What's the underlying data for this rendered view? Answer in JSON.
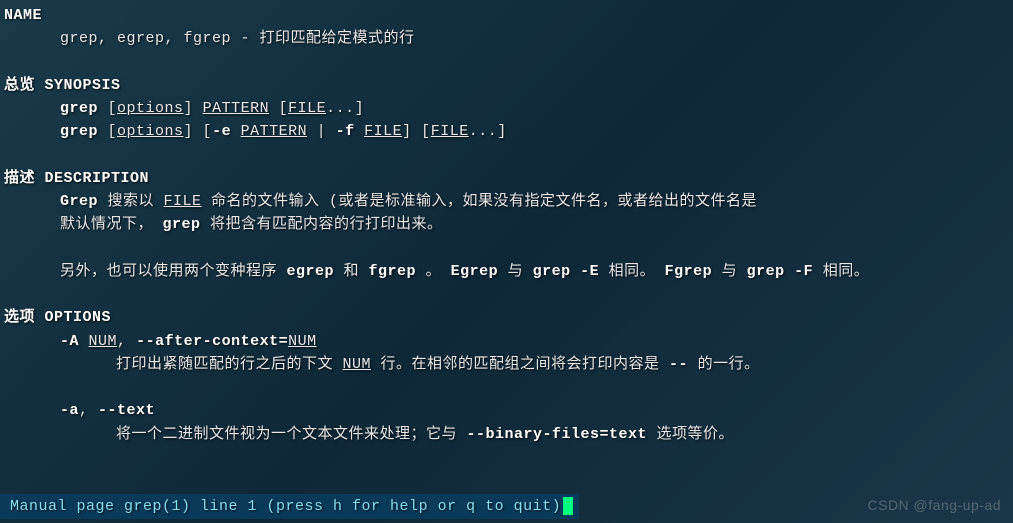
{
  "sections": {
    "name": {
      "header": "NAME",
      "line1": "grep, egrep, fgrep - 打印匹配给定模式的行"
    },
    "synopsis": {
      "header": "总览 SYNOPSIS",
      "line1_bold": "grep",
      "line1_rest_open": " [",
      "line1_opts": "options",
      "line1_mid": "] ",
      "line1_pattern": "PATTERN",
      "line1_mid2": " [",
      "line1_file": "FILE",
      "line1_end": "...]",
      "line2_bold": "grep",
      "line2_a": " [",
      "line2_opts": "options",
      "line2_b": "] [",
      "line2_e": "-e",
      "line2_sp1": " ",
      "line2_pattern": "PATTERN",
      "line2_pipe": " | ",
      "line2_f": "-f",
      "line2_sp2": " ",
      "line2_file1": "FILE",
      "line2_c": "] [",
      "line2_file2": "FILE",
      "line2_end": "...]"
    },
    "description": {
      "header": "描述 DESCRIPTION",
      "p1_grep": "Grep",
      "p1_t1": "   搜索以   ",
      "p1_file": "FILE",
      "p1_t2": "   命名的文件输入   (或者是标准输入，如果没有指定文件名，或者给出的文件名是",
      "p2_t1": "默认情况下， ",
      "p2_grep": "grep",
      "p2_t2": " 将把含有匹配内容的行打印出来。",
      "p3_t1": "另外，也可以使用两个变种程序 ",
      "p3_egrep": "egrep",
      "p3_t2": " 和 ",
      "p3_fgrep": "fgrep",
      "p3_t3": " 。 ",
      "p3_Egrep": "Egrep",
      "p3_t4": " 与 ",
      "p3_grepE": "grep -E",
      "p3_t5": " 相同。 ",
      "p3_Fgrep": "Fgrep",
      "p3_t6": " 与 ",
      "p3_grepF": "grep -F",
      "p3_t7": " 相同。"
    },
    "options": {
      "header": "选项 OPTIONS",
      "optA_flag": "-A",
      "optA_sp": " ",
      "optA_num1": "NUM",
      "optA_comma": ", ",
      "optA_long1": "--after-context=",
      "optA_num2": "NUM",
      "optA_desc_t1": "打印出紧随匹配的行之后的下文 ",
      "optA_desc_num": "NUM",
      "optA_desc_t2": " 行。在相邻的匹配组之间将会打印内容是 ",
      "optA_desc_dash": "--",
      "optA_desc_t3": " 的一行。",
      "opta_flag": "-a",
      "opta_comma": ", ",
      "opta_long": "--text",
      "opta_desc_t1": "将一个二进制文件视为一个文本文件来处理；它与 ",
      "opta_desc_bin": "--binary-files=text",
      "opta_desc_t2": " 选项等价。"
    }
  },
  "statusbar": "Manual page grep(1) line 1 (press h for help or q to quit)",
  "watermark": "CSDN @fang-up-ad"
}
